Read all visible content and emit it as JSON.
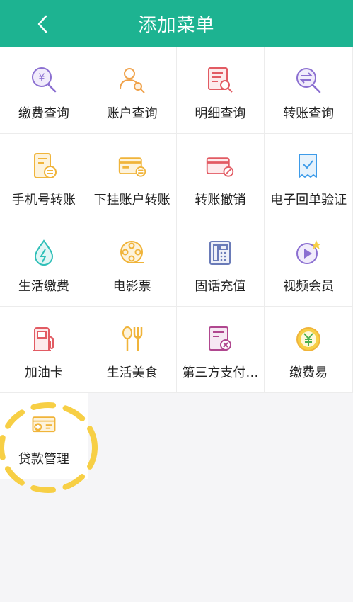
{
  "header": {
    "title": "添加菜单",
    "back_glyph": "<",
    "bg_color": "#1db391"
  },
  "menu": {
    "items": [
      {
        "label": "缴费查询",
        "icon": "yuan-search-icon"
      },
      {
        "label": "账户查询",
        "icon": "user-search-icon"
      },
      {
        "label": "明细查询",
        "icon": "document-search-icon"
      },
      {
        "label": "转账查询",
        "icon": "transfer-search-icon"
      },
      {
        "label": "手机号转账",
        "icon": "phone-transfer-icon"
      },
      {
        "label": "下挂账户转账",
        "icon": "card-transfer-icon"
      },
      {
        "label": "转账撤销",
        "icon": "card-cancel-icon"
      },
      {
        "label": "电子回单验证",
        "icon": "receipt-check-icon"
      },
      {
        "label": "生活缴费",
        "icon": "water-drop-icon"
      },
      {
        "label": "电影票",
        "icon": "film-reel-icon"
      },
      {
        "label": "固话充值",
        "icon": "landline-phone-icon"
      },
      {
        "label": "视频会员",
        "icon": "video-play-icon"
      },
      {
        "label": "加油卡",
        "icon": "fuel-pump-icon"
      },
      {
        "label": "生活美食",
        "icon": "cutlery-icon"
      },
      {
        "label": "第三方支付…",
        "icon": "third-party-pay-icon"
      },
      {
        "label": "缴费易",
        "icon": "yuan-coin-icon"
      },
      {
        "label": "贷款管理",
        "icon": "loan-card-icon"
      }
    ]
  },
  "colors": {
    "accent": "#1db391",
    "highlight": "#f7cf45",
    "purple": "#8b6fd1",
    "orange": "#f0a24a",
    "red": "#e25b63",
    "yellow": "#f0b43a",
    "blue": "#3d9be9",
    "teal": "#2fbfb8"
  }
}
